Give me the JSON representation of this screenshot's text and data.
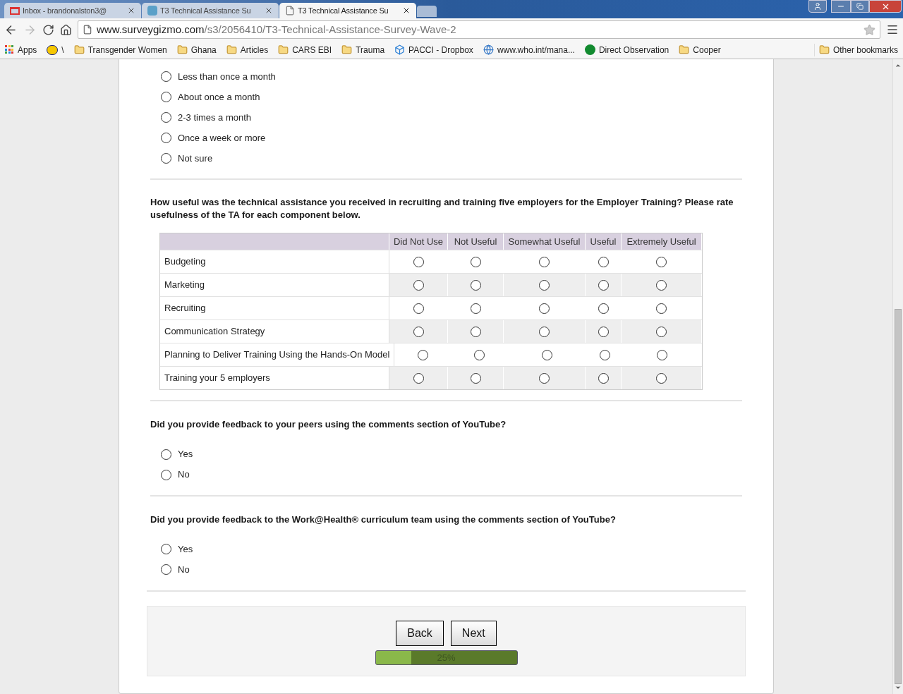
{
  "browser": {
    "tabs": [
      {
        "title": "Inbox - brandonalston3@",
        "kind": "mail",
        "selected": false
      },
      {
        "title": "T3 Technical Assistance Su",
        "kind": "sg",
        "selected": false
      },
      {
        "title": "T3 Technical Assistance Su",
        "kind": "page",
        "selected": true
      }
    ],
    "url_host": "www.surveygizmo.com",
    "url_path": "/s3/2056410/T3-Technical-Assistance-Survey-Wave-2",
    "bookmarks": [
      {
        "label": "Apps",
        "kind": "apps"
      },
      {
        "label": "\\",
        "kind": "ric"
      },
      {
        "label": "Transgender Women",
        "kind": "folder"
      },
      {
        "label": "Ghana",
        "kind": "folder"
      },
      {
        "label": "Articles",
        "kind": "folder"
      },
      {
        "label": "CARS EBI",
        "kind": "folder"
      },
      {
        "label": "Trauma",
        "kind": "folder"
      },
      {
        "label": "PACCI - Dropbox",
        "kind": "dropbox"
      },
      {
        "label": "www.who.int/mana...",
        "kind": "globe"
      },
      {
        "label": "Direct Observation",
        "kind": "circle"
      },
      {
        "label": "Cooper",
        "kind": "folder"
      }
    ],
    "other_bookmarks": "Other bookmarks"
  },
  "survey": {
    "frequency_options": [
      {
        "label": "Less than once a month",
        "selected": false
      },
      {
        "label": "About once a month",
        "selected": false
      },
      {
        "label": "2-3 times a month",
        "selected": false
      },
      {
        "label": "Once a week or more",
        "selected": false
      },
      {
        "label": "Not sure",
        "selected": false
      }
    ],
    "matrix_question": "How useful was the technical assistance you received in recruiting and training five employers for the Employer Training? Please rate usefulness of the TA for each component below.",
    "matrix": {
      "columns": [
        "Did Not Use",
        "Not Useful",
        "Somewhat Useful",
        "Useful",
        "Extremely Useful"
      ],
      "rows": [
        {
          "label": "Budgeting",
          "cells": [
            {
              "selected": false
            },
            {
              "selected": false
            },
            {
              "selected": false
            },
            {
              "selected": false
            },
            {
              "selected": false
            }
          ]
        },
        {
          "label": "Marketing",
          "cells": [
            {
              "selected": false
            },
            {
              "selected": false
            },
            {
              "selected": false
            },
            {
              "selected": false
            },
            {
              "selected": false
            }
          ]
        },
        {
          "label": "Recruiting",
          "cells": [
            {
              "selected": false
            },
            {
              "selected": false
            },
            {
              "selected": false
            },
            {
              "selected": false
            },
            {
              "selected": false
            }
          ]
        },
        {
          "label": "Communication Strategy",
          "cells": [
            {
              "selected": false
            },
            {
              "selected": false
            },
            {
              "selected": false
            },
            {
              "selected": false
            },
            {
              "selected": false
            }
          ]
        },
        {
          "label": "Planning to Deliver Training Using the Hands-On Model",
          "cells": [
            {
              "selected": false
            },
            {
              "selected": false
            },
            {
              "selected": false
            },
            {
              "selected": false
            },
            {
              "selected": false
            }
          ]
        },
        {
          "label": "Training your 5 employers",
          "cells": [
            {
              "selected": false
            },
            {
              "selected": false
            },
            {
              "selected": false
            },
            {
              "selected": false
            },
            {
              "selected": false
            }
          ]
        }
      ]
    },
    "questions": [
      {
        "text": "Did you provide feedback to your peers using the comments section of YouTube?",
        "options": [
          {
            "label": "Yes",
            "selected": false
          },
          {
            "label": "No",
            "selected": false
          }
        ]
      },
      {
        "text": "Did you provide feedback to the Work@Health® curriculum team using the comments section of YouTube?",
        "options": [
          {
            "label": "Yes",
            "selected": false
          },
          {
            "label": "No",
            "selected": false
          }
        ]
      }
    ],
    "buttons": [
      "Back",
      "Next"
    ],
    "progress": {
      "level": 0.25,
      "label": "25%"
    }
  }
}
